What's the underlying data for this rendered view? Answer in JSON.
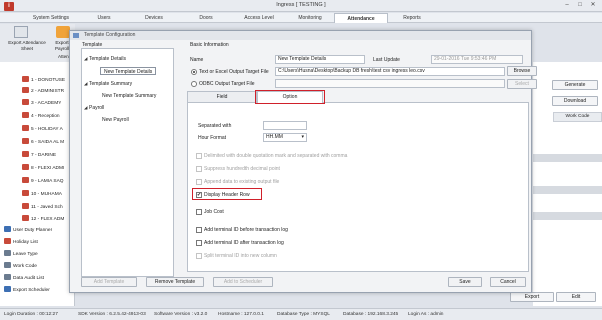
{
  "window": {
    "title": "Ingress [ TESTING ]",
    "minimize": "–",
    "maximize": "□",
    "close": "✕"
  },
  "menu": [
    "System Settings",
    "Users",
    "Devices",
    "Doors",
    "Access Level",
    "Monitoring",
    "Attendance",
    "Reports"
  ],
  "menu_active": "Attendance",
  "toolbar": {
    "export_sheet_l1": "Export Attendance",
    "export_sheet_l2": "Sheet",
    "export_payroll_l1": "Export",
    "export_payroll_l2": "Payroll",
    "atten_label": "Atten"
  },
  "sidebar": {
    "items": [
      "1 - DONOTUSE",
      "2 - ADMINISTR",
      "3 - ACADEMY",
      "4 - Reception",
      "5 - HOLIDAY A",
      "6 - SAIDA AL M",
      "7 - DARINE",
      "8 - FLEXI ADMI",
      "9 - LAMIA SAQ",
      "10 - MUHAMA",
      "11 - Javed Sch",
      "12 - FLEX ADM"
    ],
    "bottom": [
      "User Duty Planner",
      "Holiday List",
      "Leave Type",
      "Work Code",
      "Data Audit List",
      "Export Scheduler"
    ]
  },
  "right_panel": {
    "generate": "Generate",
    "download": "Download",
    "col_header": "Work Code",
    "export": "Export",
    "edit": "Edit"
  },
  "dialog": {
    "title": "Template Configuration",
    "template_group": "Template",
    "tree": [
      {
        "label": "Template Details",
        "expander": "◢"
      },
      {
        "label": "New Template Details",
        "selected": true
      },
      {
        "label": "Template Summary",
        "expander": "◢"
      },
      {
        "label": "New Template Summary"
      },
      {
        "label": "Payroll",
        "expander": "◢"
      },
      {
        "label": "New Payroll"
      }
    ],
    "basic_info": "Basic Information",
    "name_label": "Name",
    "name_value": "New Template Details",
    "last_update_label": "Last Update",
    "last_update_value": "29-01-2016  Tue  9:53:46 PM",
    "text_output_label": "Text or Excel Output Target File",
    "text_output_value": "C:\\Users\\Husna\\Desktop\\Backup DB fresh\\test csv ingress leo.csv",
    "browse": "Browse",
    "odbc_label": "ODBC Output Target File",
    "odbc_value": "",
    "select": "Select",
    "tab_field": "Field",
    "tab_option": "Option",
    "separated_with": "Separated with",
    "separated_value": "",
    "hour_format": "Hour Format",
    "hour_format_value": "HH.MM",
    "hour_format_arrow": "▾",
    "opt_delimited": "Delimited with double quotation mark and separated with comma",
    "opt_suppress": "Suppress hundredth decimal point",
    "opt_append": "Append data to existing output file",
    "opt_header": "Display Header Row",
    "opt_jobcost": "Job Cost",
    "opt_terminal_before": "Add terminal ID before transaction log",
    "opt_terminal_after": "Add terminal ID after transaction log",
    "opt_split": "Split terminal ID into new column",
    "add_template": "Add Template",
    "remove_template": "Remove Template",
    "add_scheduler": "Add to Scheduler",
    "save": "Save",
    "cancel": "Cancel",
    "check_mark": "✔"
  },
  "status": {
    "login_duration": "Login Duration : 00:12:27",
    "sdk": "SDK Version : 6.2.5.42-4913-03",
    "software": "Software Version : v3.2.0",
    "hostname": "Hostname : 127.0.0.1",
    "dbtype": "Database Type : MYSQL",
    "database": "Database : 192.168.3.245",
    "login_as": "Login As : admin"
  },
  "colors": {
    "accent_red": "#d0202a",
    "logo_red": "#c0392b"
  }
}
